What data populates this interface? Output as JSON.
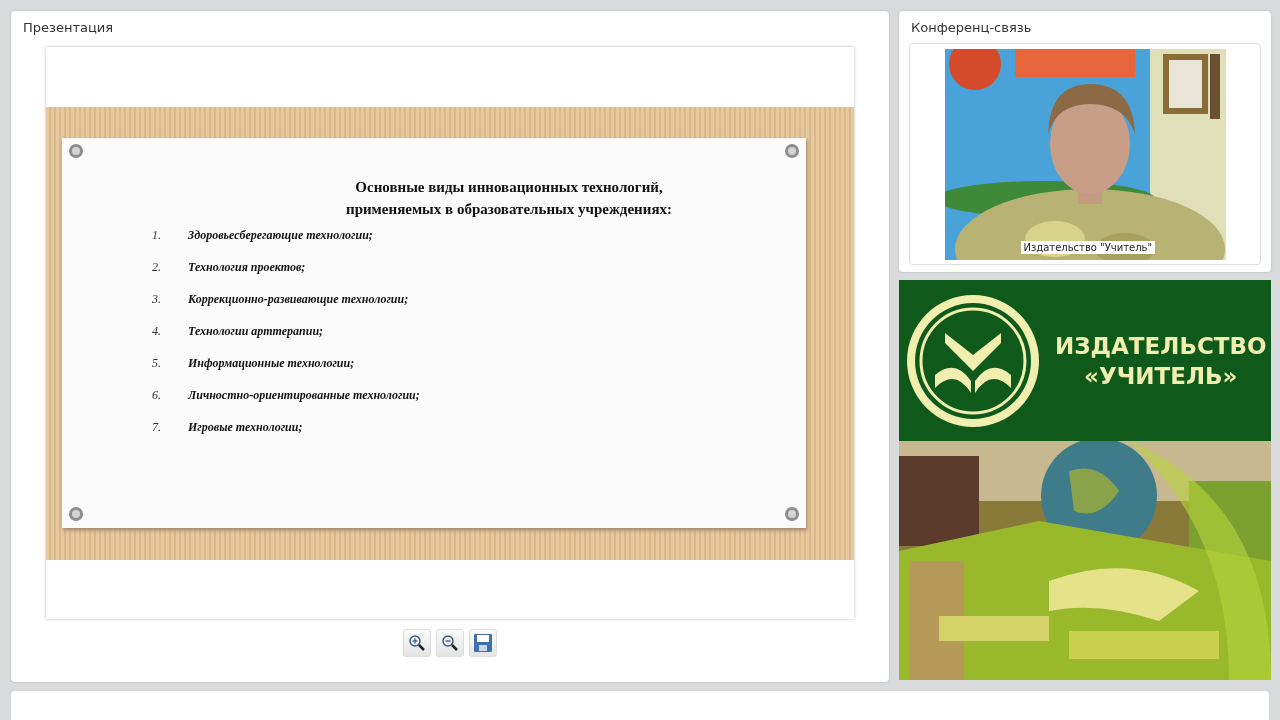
{
  "presentation": {
    "title": "Презентация",
    "slide": {
      "heading": [
        "Основные виды инновационных технологий,",
        "применяемых в образовательных учреждениях:"
      ],
      "items": [
        {
          "number": "1.",
          "text": "Здоровьесберегающие технологии;"
        },
        {
          "number": "2.",
          "text": "Технология проектов;"
        },
        {
          "number": "3.",
          "text": "Коррекционно-развивающие технологии;"
        },
        {
          "number": "4.",
          "text": "Технологии арттерапии;"
        },
        {
          "number": "5.",
          "text": "Информационные технологии;"
        },
        {
          "number": "6.",
          "text": "Личностно-ориентированные технологии;"
        },
        {
          "number": "7.",
          "text": "Игровые технологии;"
        }
      ]
    },
    "toolbar": [
      {
        "kind": "zoom-in"
      },
      {
        "kind": "zoom-out"
      },
      {
        "kind": "save"
      }
    ]
  },
  "conference": {
    "title": "Конференц-связь",
    "video": {
      "kind": "picture",
      "caption": "Издательство \"Учитель\""
    }
  },
  "banner": {
    "lines": [
      "ИЗДАТЕЛЬСТВО",
      "«УЧИТЕЛЬ»"
    ],
    "photo": {
      "kind": "picture"
    }
  }
}
